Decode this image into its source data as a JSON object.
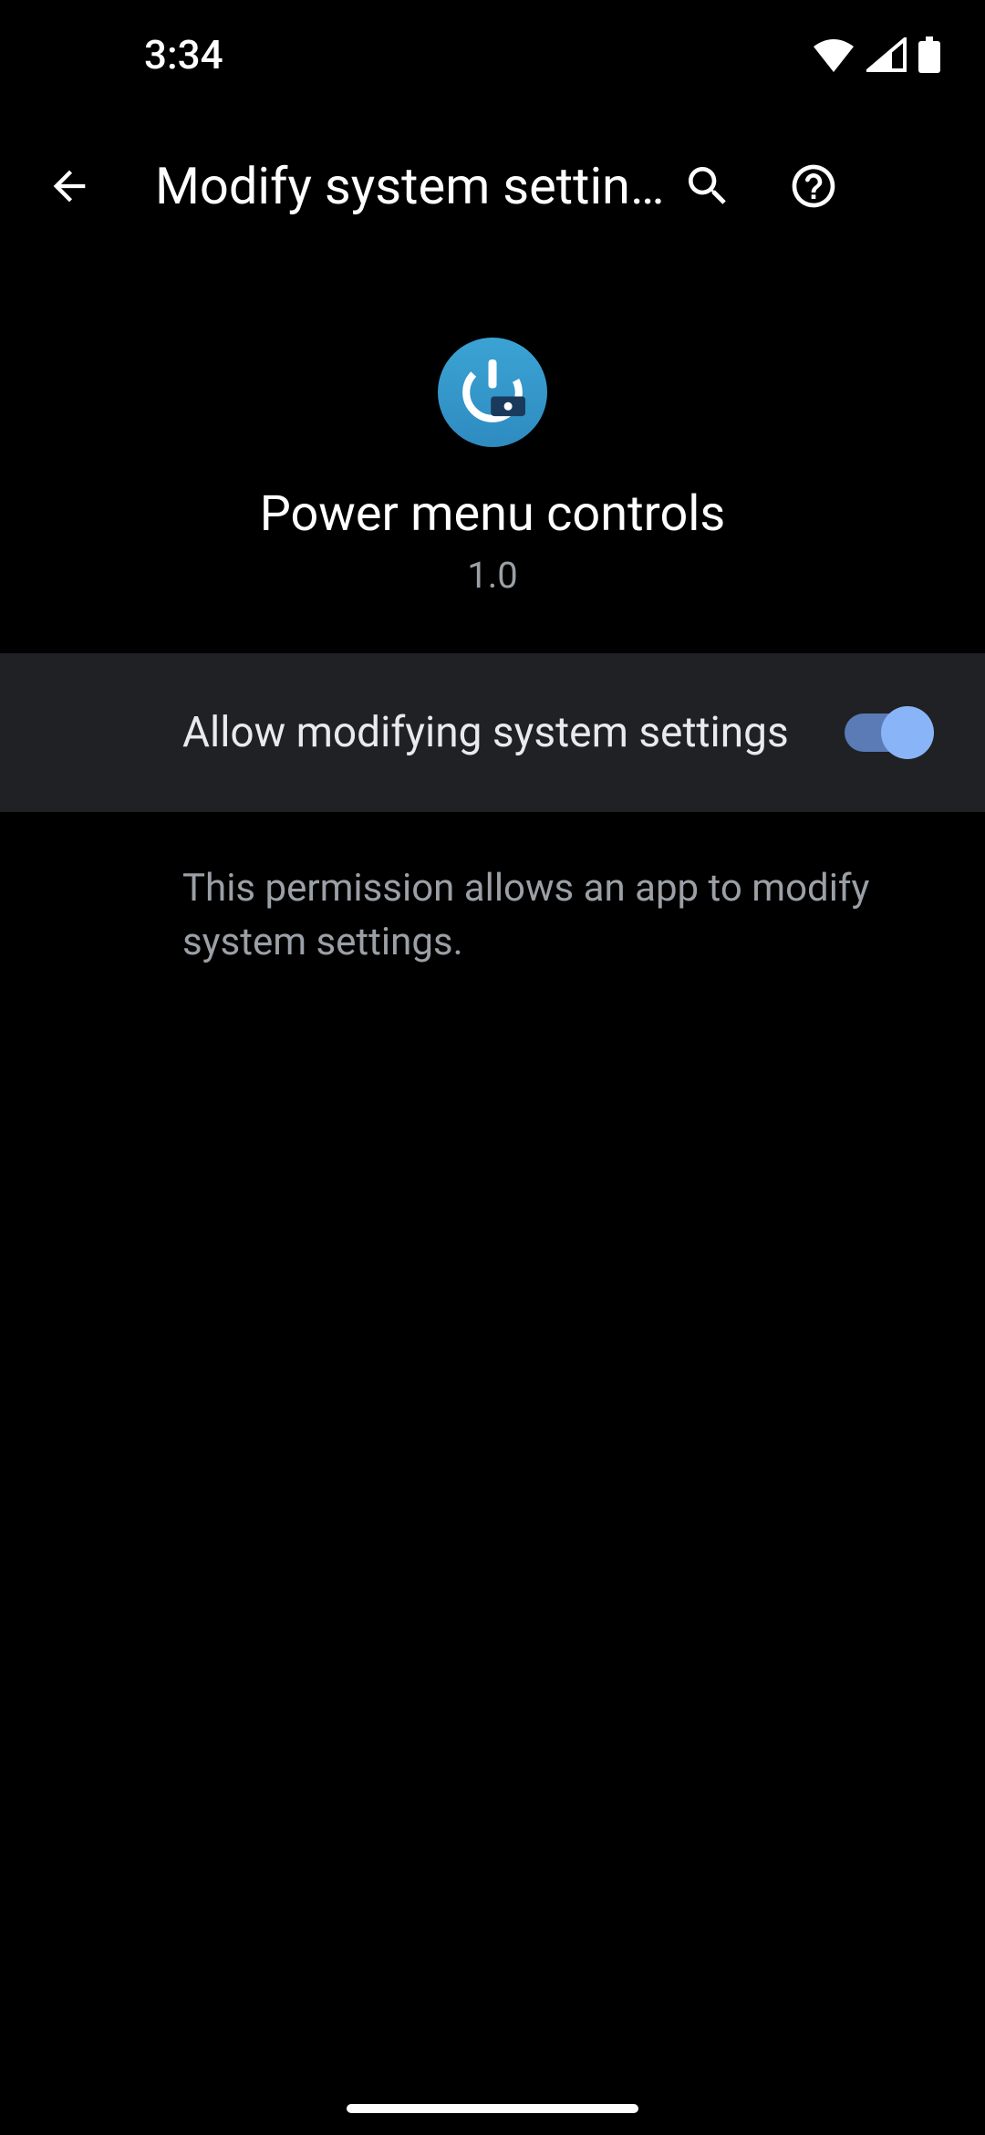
{
  "status": {
    "time": "3:34"
  },
  "header": {
    "title": "Modify system settin…"
  },
  "app": {
    "name": "Power menu controls",
    "version": "1.0"
  },
  "permission": {
    "label": "Allow modifying system settings",
    "enabled": true,
    "description": "This permission allows an app to modify system settings."
  }
}
